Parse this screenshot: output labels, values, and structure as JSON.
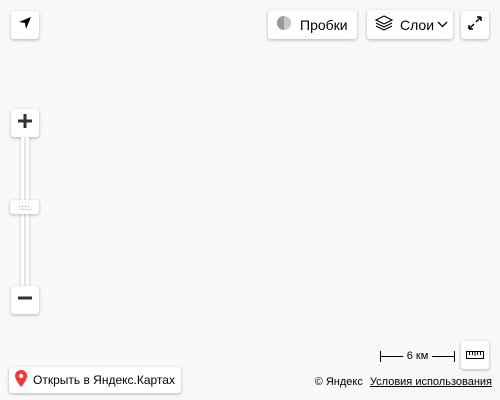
{
  "controls": {
    "geolocation_icon": "arrow-navigate-icon",
    "traffic": {
      "label": "Пробки",
      "icon": "traffic-light-icon"
    },
    "layers": {
      "label": "Слои",
      "icon": "layers-icon",
      "chevron": "chevron-down-icon"
    },
    "fullscreen_icon": "expand-icon",
    "zoom": {
      "in_icon": "plus-icon",
      "out_icon": "minus-icon"
    },
    "ruler_icon": "ruler-icon"
  },
  "open_map": {
    "label": "Открыть в Яндекс.Картах",
    "icon": "location-pin-icon",
    "pin_color": "#f33"
  },
  "scale": {
    "label": "6 км"
  },
  "footer": {
    "copyright": "© Яндекс",
    "terms": "Условия использования"
  }
}
